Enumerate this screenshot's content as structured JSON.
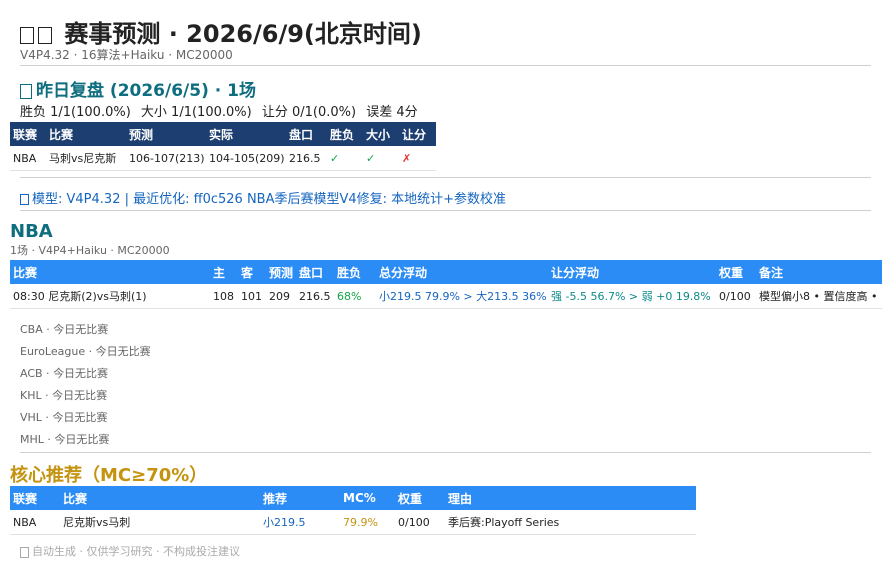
{
  "header": {
    "title": "赛事预测 · 2026/6/9(北京时间)",
    "subtitle": "V4P4.32 · 16算法+Haiku · MC20000"
  },
  "review": {
    "title": "昨日复盘 (2026/6/5) · 1场",
    "stats": [
      "胜负 1/1(100.0%)",
      "大小 1/1(100.0%)",
      "让分 0/1(0.0%)",
      "误差 4分"
    ],
    "columns": [
      "联赛",
      "比赛",
      "预测",
      "实际",
      "盘口",
      "胜负",
      "大小",
      "让分"
    ],
    "rows": [
      {
        "league": "NBA",
        "match": "马刺vs尼克斯",
        "pred": "106-107(213)",
        "actual": "104-105(209)",
        "line": "216.5",
        "wl": "✓",
        "ou": "✓",
        "ats": "✗"
      }
    ]
  },
  "model_note": "模型: V4P4.32 | 最近优化: ff0c526 NBA季后赛模型V4修复: 本地统计+参数校准",
  "nba": {
    "name": "NBA",
    "meta": "1场 · V4P4+Haiku · MC20000",
    "columns": [
      "比赛",
      "主",
      "客",
      "预测",
      "盘口",
      "胜负",
      "总分浮动",
      "让分浮动",
      "权重",
      "备注"
    ],
    "rows": [
      {
        "match": "08:30 尼克斯(2)vs马刺(1)",
        "home": "108",
        "away": "101",
        "pred": "209",
        "line": "216.5",
        "win": "68%",
        "total": "小219.5 79.9% > 大213.5 36%",
        "spread": "强 -5.5 56.7% > 弱 +0 19.8%",
        "weight": "0/100",
        "note": "模型偏小8 • 置信度高 •"
      }
    ]
  },
  "other_leagues": [
    {
      "league": "CBA",
      "status": "今日无比赛"
    },
    {
      "league": "EuroLeague",
      "status": "今日无比赛"
    },
    {
      "league": "ACB",
      "status": "今日无比赛"
    },
    {
      "league": "KHL",
      "status": "今日无比赛"
    },
    {
      "league": "VHL",
      "status": "今日无比赛"
    },
    {
      "league": "MHL",
      "status": "今日无比赛"
    }
  ],
  "core": {
    "title": "核心推荐（MC≥70%）",
    "columns": [
      "联赛",
      "比赛",
      "推荐",
      "MC%",
      "权重",
      "理由"
    ],
    "rows": [
      {
        "league": "NBA",
        "match": "尼克斯vs马刺",
        "pick": "小219.5",
        "mc": "79.9%",
        "weight": "0/100",
        "reason": "季后赛:Playoff Series"
      }
    ]
  },
  "footer": "自动生成 · 仅供学习研究 · 不构成投注建议",
  "colors": {
    "navy": "#1c3e70",
    "blue": "#2b8cf5",
    "teal": "#0e6e80",
    "gold": "#c49310",
    "green": "#17a34a"
  }
}
